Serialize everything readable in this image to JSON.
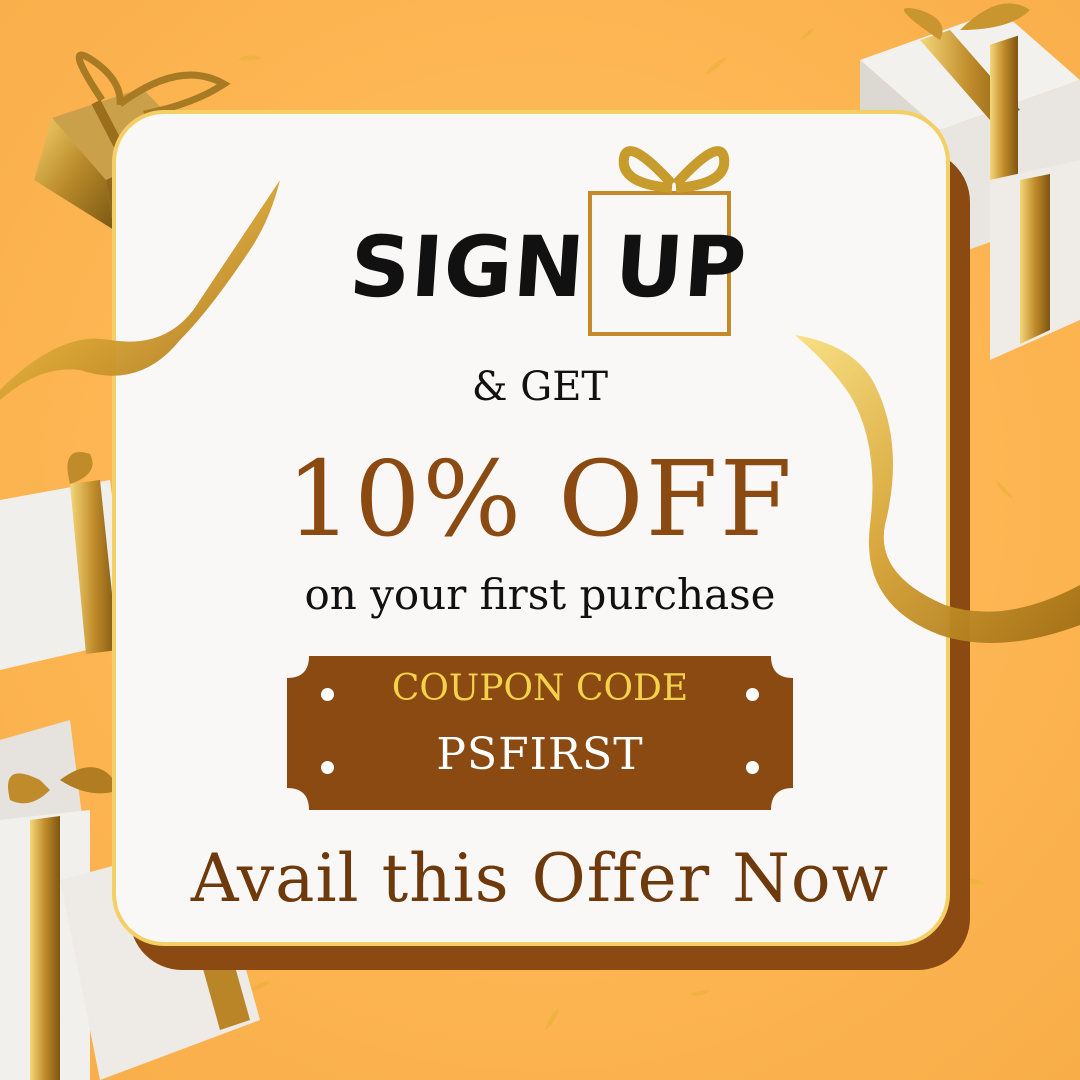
{
  "promo": {
    "headline_word1": "SIGN",
    "headline_word2": "UP",
    "get_text": "& GET",
    "discount_text": "10% OFF",
    "subtext": "on your first purchase",
    "coupon_label": "COUPON CODE",
    "coupon_code": "PSFIRST",
    "cta_text": "Avail this Offer Now"
  },
  "colors": {
    "background": "#fdb653",
    "card": "#faf8f6",
    "accent_brown": "#8a4a12",
    "gold": "#f4d24a"
  },
  "icons": [
    "gift-box-icon",
    "ribbon-decoration"
  ]
}
